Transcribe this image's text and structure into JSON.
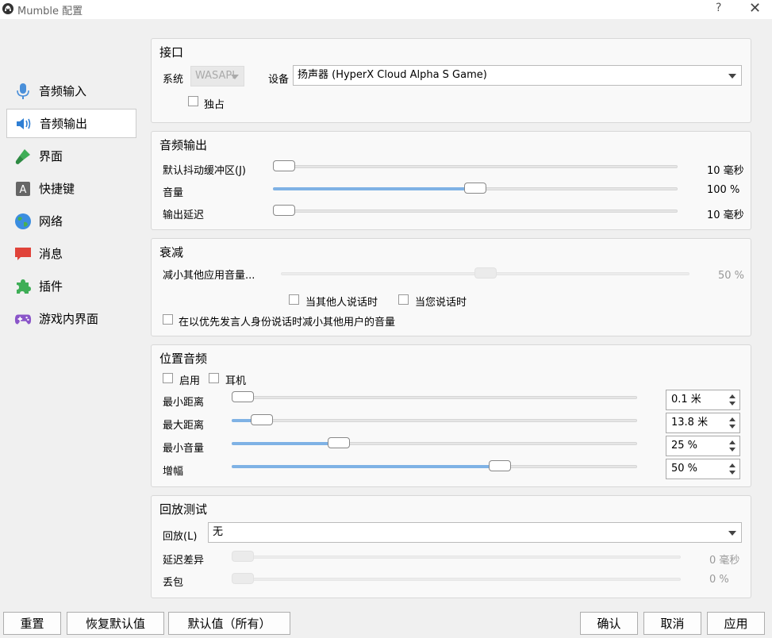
{
  "window": {
    "title": "Mumble 配置",
    "help": "?",
    "close": "✕"
  },
  "sidebar": {
    "items": [
      {
        "label": "音频输入",
        "icon": "microphone-icon"
      },
      {
        "label": "音频输出",
        "icon": "speaker-icon",
        "selected": true
      },
      {
        "label": "界面",
        "icon": "paintbrush-icon"
      },
      {
        "label": "快捷键",
        "icon": "keyboard-key-icon",
        "glyph": "A"
      },
      {
        "label": "网络",
        "icon": "globe-icon"
      },
      {
        "label": "消息",
        "icon": "chat-bubble-icon"
      },
      {
        "label": "插件",
        "icon": "puzzle-icon"
      },
      {
        "label": "游戏内界面",
        "icon": "gamepad-icon"
      }
    ]
  },
  "interface": {
    "title": "接口",
    "system_label": "系统",
    "system_value": "WASAPI",
    "device_label": "设备",
    "device_value": "扬声器 (HyperX Cloud Alpha S Game)",
    "exclusive_label": "独占"
  },
  "audio_output": {
    "title": "音频输出",
    "rows": [
      {
        "label": "默认抖动缓冲区(J)",
        "value": "10 毫秒",
        "level": 0.0
      },
      {
        "label": "音量",
        "value": "100 %",
        "level": 0.5
      },
      {
        "label": "输出延迟",
        "value": "10 毫秒",
        "level": 0.0
      }
    ]
  },
  "attenuation": {
    "title": "衰减",
    "reduce_label": "减小其他应用音量...",
    "reduce_value": "50 %",
    "reduce_level": 0.5,
    "when_others_label": "当其他人说话时",
    "when_you_label": "当您说话时",
    "priority_label": "在以优先发言人身份说话时减小其他用户的音量"
  },
  "positional": {
    "title": "位置音频",
    "enable_label": "启用",
    "headphones_label": "耳机",
    "rows": [
      {
        "label": "最小距离",
        "value": "0.1 米",
        "level": 0.0
      },
      {
        "label": "最大距离",
        "value": "13.8 米",
        "level": 0.05
      },
      {
        "label": "最小音量",
        "value": "25 %",
        "level": 0.25
      },
      {
        "label": "增幅",
        "value": "50 %",
        "level": 0.67
      }
    ]
  },
  "loopback": {
    "title": "回放测试",
    "mode_label": "回放(L)",
    "mode_value": "无",
    "delay_label": "延迟差异",
    "delay_value": "0 毫秒",
    "loss_label": "丢包",
    "loss_value": "0 %"
  },
  "buttons": {
    "reset": "重置",
    "restore_defaults": "恢复默认值",
    "defaults_all": "默认值（所有）",
    "ok": "确认",
    "cancel": "取消",
    "apply": "应用"
  },
  "colors": {
    "slider_fill": "#7fb2e5",
    "selected_bg": "#ffffff"
  }
}
